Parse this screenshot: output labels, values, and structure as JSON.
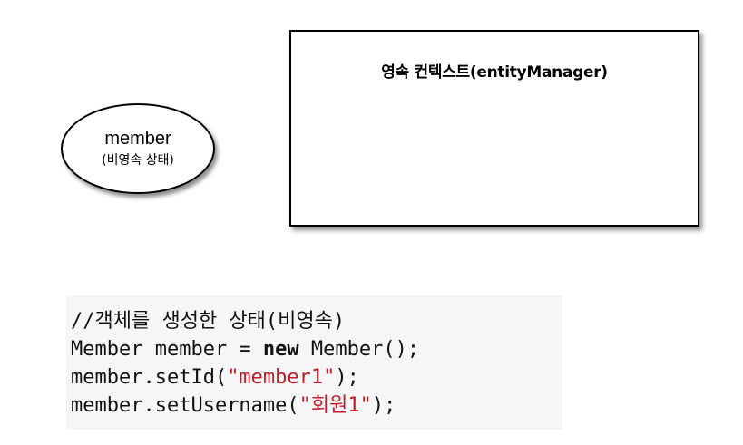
{
  "entity": {
    "name": "member",
    "state": "(비영속 상태)"
  },
  "context": {
    "title": "영속 컨텍스트(entityManager)"
  },
  "code": {
    "comment": "//객체를 생성한 상태(비영속)",
    "line2_pre": "Member member = ",
    "line2_kw": "new",
    "line2_post": " Member();",
    "line3_pre": "member.setId(",
    "line3_str": "\"member1\"",
    "line3_post": ");",
    "line4_pre": "member.setUsername(",
    "line4_str": "\"회원1\"",
    "line4_post": ");"
  },
  "colors": {
    "string_literal": "#c41a2a",
    "code_background": "#f6f6f6"
  }
}
